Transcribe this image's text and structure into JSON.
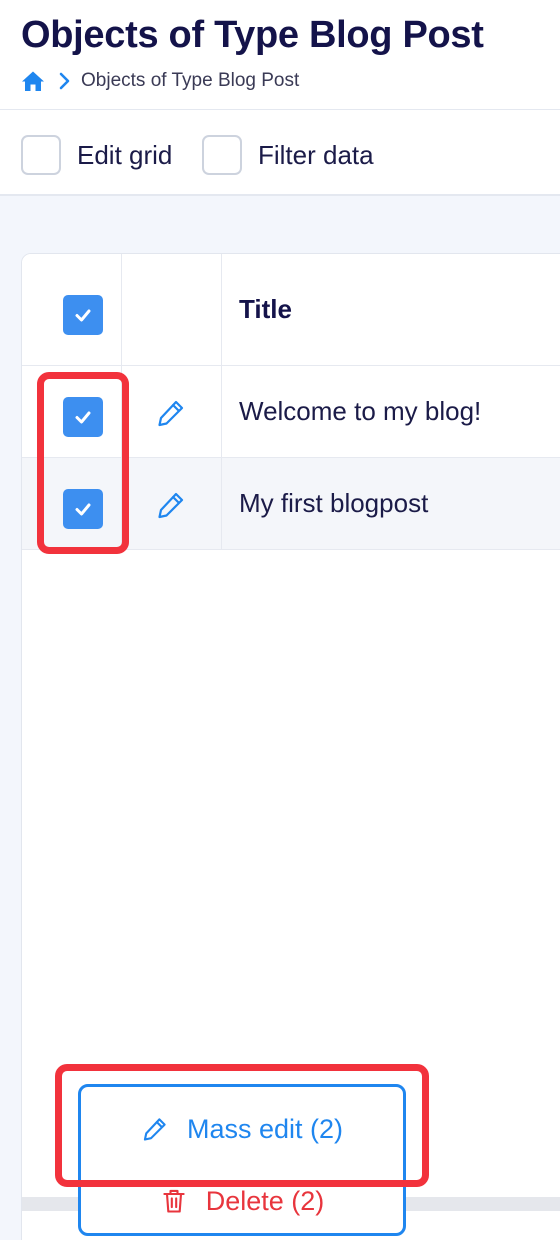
{
  "header": {
    "title": "Objects of Type Blog Post",
    "breadcrumb": {
      "home_icon": "home-icon",
      "separator_icon": "chevron-right-icon",
      "current": "Objects of Type Blog Post"
    }
  },
  "toolbar": {
    "edit_grid_label": "Edit grid",
    "filter_data_label": "Filter data"
  },
  "grid": {
    "columns": [
      "Title"
    ],
    "select_all_checked": true,
    "rows": [
      {
        "title": "Welcome to my blog!",
        "checked": true,
        "edit_icon": "pencil-icon"
      },
      {
        "title": "My first blogpost",
        "checked": true,
        "edit_icon": "pencil-icon"
      }
    ]
  },
  "actions": {
    "mass_edit_label": "Mass edit (2)",
    "delete_label": "Delete (2)"
  },
  "colors": {
    "accent": "#3d8ff0",
    "action_blue": "#1f86ef",
    "danger": "#e8353d",
    "highlight": "#f2323c",
    "title_text": "#14134a"
  }
}
